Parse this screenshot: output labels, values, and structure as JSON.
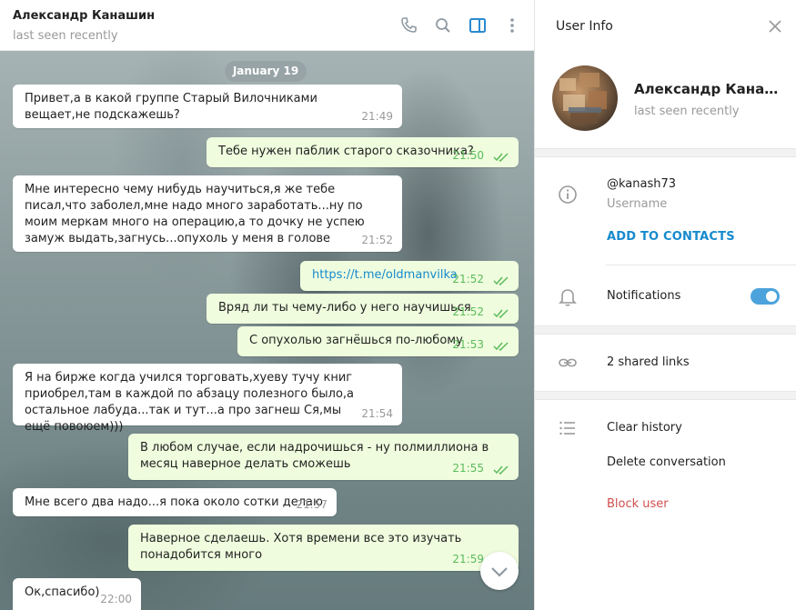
{
  "chat": {
    "header": {
      "title": "Александр Канашин",
      "status": "last seen recently",
      "icons": [
        "phone-icon",
        "search-icon",
        "sidebar-toggle-icon",
        "more-icon"
      ]
    },
    "date_label": "January 19",
    "messages": [
      {
        "dir": "in",
        "text": "Привет,а в какой группе Старый Вилочниками вещает,не подскажешь?",
        "time": "21:49"
      },
      {
        "dir": "out",
        "text": "Тебе нужен паблик старого сказочника?",
        "time": "21:50"
      },
      {
        "dir": "in",
        "text": "Мне интересно чему нибудь научиться,я же тебе писал,что заболел,мне надо много заработать...ну по моим меркам много на операцию,а то дочку не успею замуж выдать,загнусь...опухоль у меня в голове",
        "time": "21:52"
      },
      {
        "dir": "out",
        "text": "https://t.me/oldmanvilka",
        "time": "21:52"
      },
      {
        "dir": "out",
        "text": "Вряд ли ты чему-либо у него научишься",
        "time": "21:52"
      },
      {
        "dir": "out",
        "text": "С опухолью загнёшься по-любому",
        "time": "21:53"
      },
      {
        "dir": "in",
        "text": "Я на бирже когда учился торговать,хуеву тучу книг приобрел,там в каждой по абзацу полезного было,а остальное лабуда...так и тут...а про загнеш Ся,мы ещё повоюем)))",
        "time": "21:54"
      },
      {
        "dir": "out",
        "text": "В любом случае, если надрочишься - ну полмиллиона в месяц наверное делать сможешь",
        "time": "21:55"
      },
      {
        "dir": "in",
        "text": "Мне всего два надо...я пока около сотки делаю",
        "time": "21:57"
      },
      {
        "dir": "out",
        "text": "Наверное сделаешь. Хотя времени все это изучать понадобится много",
        "time": "21:59"
      },
      {
        "dir": "in",
        "text": "Ок,спасибо)",
        "time": "22:00"
      }
    ],
    "colors": {
      "outgoing_bubble": "#effdde",
      "incoming_bubble": "#ffffff",
      "check": "#5cbb5c",
      "link": "#168acd"
    }
  },
  "info": {
    "title": "User Info",
    "name": "Александр Канашин",
    "status": "last seen recently",
    "username": "@kanash73",
    "username_label": "Username",
    "add_contact": "ADD TO CONTACTS",
    "notifications_label": "Notifications",
    "notifications_on": true,
    "shared_links": "2 shared links",
    "clear_history": "Clear history",
    "delete_conversation": "Delete conversation",
    "block_user": "Block user",
    "colors": {
      "accent": "#168acd",
      "danger": "#d14e4e",
      "toggle": "#4ca3dc"
    }
  }
}
